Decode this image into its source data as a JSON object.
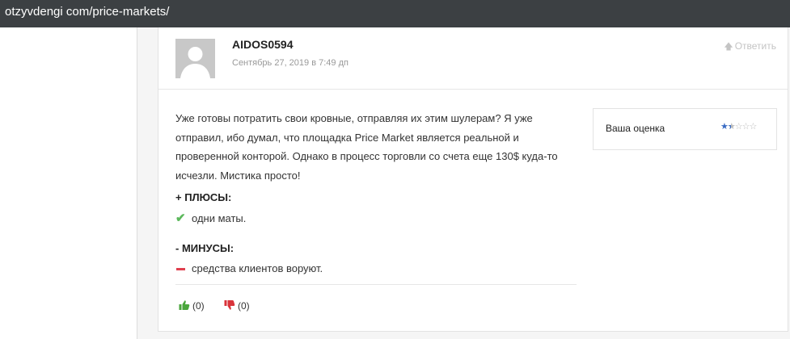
{
  "browser": {
    "url": "otzyvdengi com/price-markets/"
  },
  "comment": {
    "author": "AIDOS0594",
    "date": "Сентябрь 27, 2019 в 7:49 дп",
    "reply_label": "Ответить",
    "text": "Уже готовы потратить свои кровные, отправляя их этим шулерам? Я уже отправил, ибо думал, что площадка Price Market является реальной и проверенной конторой. Однако в процесс торговли со счета еще 130$ куда-то исчезли. Мистика просто!",
    "pros_title": "+ ПЛЮСЫ:",
    "pros": [
      "одни маты."
    ],
    "cons_title": "- МИНУСЫ:",
    "cons": [
      "средства клиентов воруют."
    ],
    "likes": "(0)",
    "dislikes": "(0)",
    "rating_label": "Ваша оценка",
    "rating": 1.5,
    "rating_max": 5
  },
  "colors": {
    "accent_blue": "#3a6cc4",
    "check_green": "#5cb85c",
    "minus_red": "#e0404f",
    "urlbar": "#3c4043"
  },
  "icons": {
    "pros": "check-icon",
    "cons": "minus-icon",
    "like": "thumbs-up-icon",
    "dislike": "thumbs-down-icon",
    "reply": "arrow-up-icon"
  }
}
